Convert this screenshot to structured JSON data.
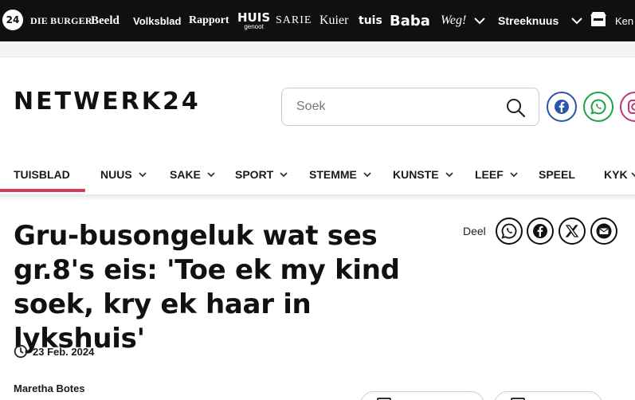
{
  "topbar": {
    "brand_badge": "24",
    "publications": [
      "DIE BURGER",
      "Beeld",
      "Volksblad",
      "Rapport",
      "HUIS",
      "genoot",
      "SARIE",
      "Kuier",
      "tuis",
      "Baba",
      "Weg!"
    ],
    "streeknuus_label": "Streeknuus",
    "store_label": "Ken"
  },
  "header": {
    "logo_text": "NETWERK24",
    "search": {
      "placeholder": "Soek",
      "value": ""
    },
    "social": [
      "facebook-icon",
      "whatsapp-icon",
      "instagram-icon"
    ]
  },
  "nav": {
    "items": [
      {
        "label": "TUISBLAD",
        "dropdown": false,
        "active": true
      },
      {
        "label": "NUUS",
        "dropdown": true
      },
      {
        "label": "SAKE",
        "dropdown": true
      },
      {
        "label": "SPORT",
        "dropdown": true
      },
      {
        "label": "STEMME",
        "dropdown": true
      },
      {
        "label": "KUNSTE",
        "dropdown": true
      },
      {
        "label": "LEEF",
        "dropdown": true
      },
      {
        "label": "SPEEL",
        "dropdown": false
      },
      {
        "label": "KYK",
        "dropdown": true
      }
    ],
    "accent_color": "#d63857"
  },
  "article": {
    "headline": "Gru-busongeluk wat ses gr.8's eis: 'Toe ek my kind soek, kry ek haar in lykshuis'",
    "share_label": "Deel",
    "share_icons": [
      "whatsapp-icon",
      "facebook-icon",
      "x-icon",
      "mail-icon"
    ],
    "date": "23 Feb. 2024",
    "author": "Maretha Botes"
  }
}
